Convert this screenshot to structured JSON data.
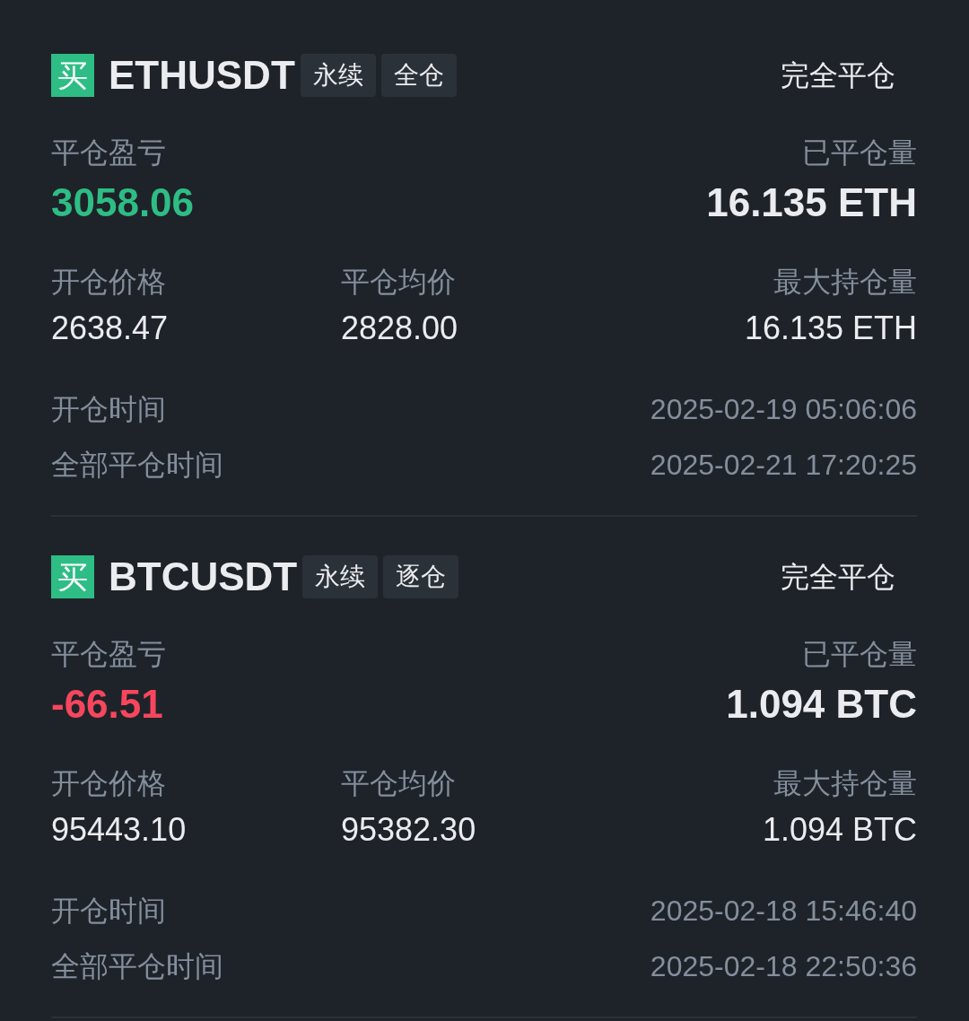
{
  "positions": [
    {
      "side": {
        "label": "买",
        "kind": "buy"
      },
      "symbol": "ETHUSDT",
      "tags": [
        "永续",
        "全仓"
      ],
      "action": "完全平仓",
      "pnl_label": "平仓盈亏",
      "pnl": {
        "value": "3058.06",
        "kind": "profit"
      },
      "closed_label": "已平仓量",
      "closed_value": "16.135 ETH",
      "open_price_label": "开仓价格",
      "open_price": "2638.47",
      "avg_close_label": "平仓均价",
      "avg_close": "2828.00",
      "max_label": "最大持仓量",
      "max_value": "16.135 ETH",
      "times": [
        {
          "label": "开仓时间",
          "value": "2025-02-19 05:06:06"
        },
        {
          "label": "全部平仓时间",
          "value": "2025-02-21 17:20:25"
        }
      ]
    },
    {
      "side": {
        "label": "买",
        "kind": "buy"
      },
      "symbol": "BTCUSDT",
      "tags": [
        "永续",
        "逐仓"
      ],
      "action": "完全平仓",
      "pnl_label": "平仓盈亏",
      "pnl": {
        "value": "-66.51",
        "kind": "loss"
      },
      "closed_label": "已平仓量",
      "closed_value": "1.094 BTC",
      "open_price_label": "开仓价格",
      "open_price": "95443.10",
      "avg_close_label": "平仓均价",
      "avg_close": "95382.30",
      "max_label": "最大持仓量",
      "max_value": "1.094 BTC",
      "times": [
        {
          "label": "开仓时间",
          "value": "2025-02-18 15:46:40"
        },
        {
          "label": "全部平仓时间",
          "value": "2025-02-18 22:50:36"
        }
      ]
    }
  ]
}
